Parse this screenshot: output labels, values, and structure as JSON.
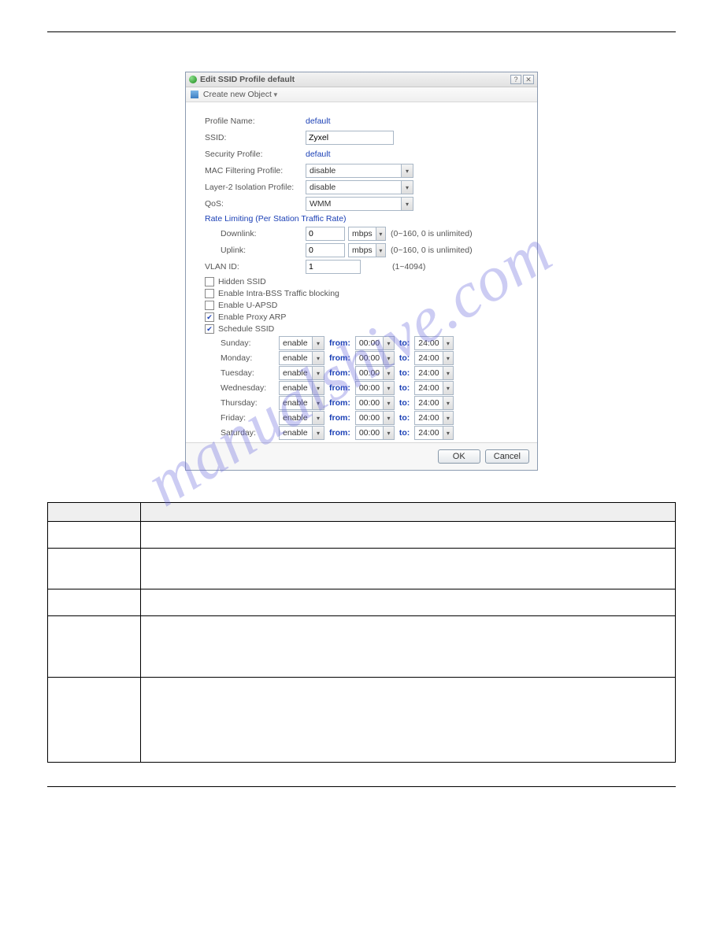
{
  "watermark": "manualshive.com",
  "dialog": {
    "title": "Edit SSID Profile default",
    "toolbar": {
      "label": "Create new Object"
    },
    "fields": {
      "profile_name_label": "Profile Name:",
      "profile_name_value": "default",
      "ssid_label": "SSID:",
      "ssid_value": "Zyxel",
      "security_label": "Security Profile:",
      "security_value": "default",
      "mac_label": "MAC Filtering Profile:",
      "mac_value": "disable",
      "layer2_label": "Layer-2 Isolation Profile:",
      "layer2_value": "disable",
      "qos_label": "QoS:",
      "qos_value": "WMM",
      "rate_header": "Rate Limiting (Per Station Traffic Rate)",
      "downlink_label": "Downlink:",
      "downlink_value": "0",
      "uplink_label": "Uplink:",
      "uplink_value": "0",
      "rate_unit": "mbps",
      "rate_hint": "(0~160, 0 is unlimited)",
      "vlan_label": "VLAN ID:",
      "vlan_value": "1",
      "vlan_hint": "(1~4094)"
    },
    "checks": {
      "hidden": "Hidden SSID",
      "intra": "Enable Intra-BSS Traffic blocking",
      "uapsd": "Enable U-APSD",
      "proxy": "Enable Proxy ARP",
      "sched": "Schedule SSID"
    },
    "schedule": {
      "days": [
        "Sunday:",
        "Monday:",
        "Tuesday:",
        "Wednesday:",
        "Thursday:",
        "Friday:",
        "Saturday:"
      ],
      "enable": "enable",
      "from_kw": "from:",
      "to_kw": "to:",
      "from_time": "00:00",
      "to_time": "24:00"
    },
    "buttons": {
      "ok": "OK",
      "cancel": "Cancel"
    }
  }
}
